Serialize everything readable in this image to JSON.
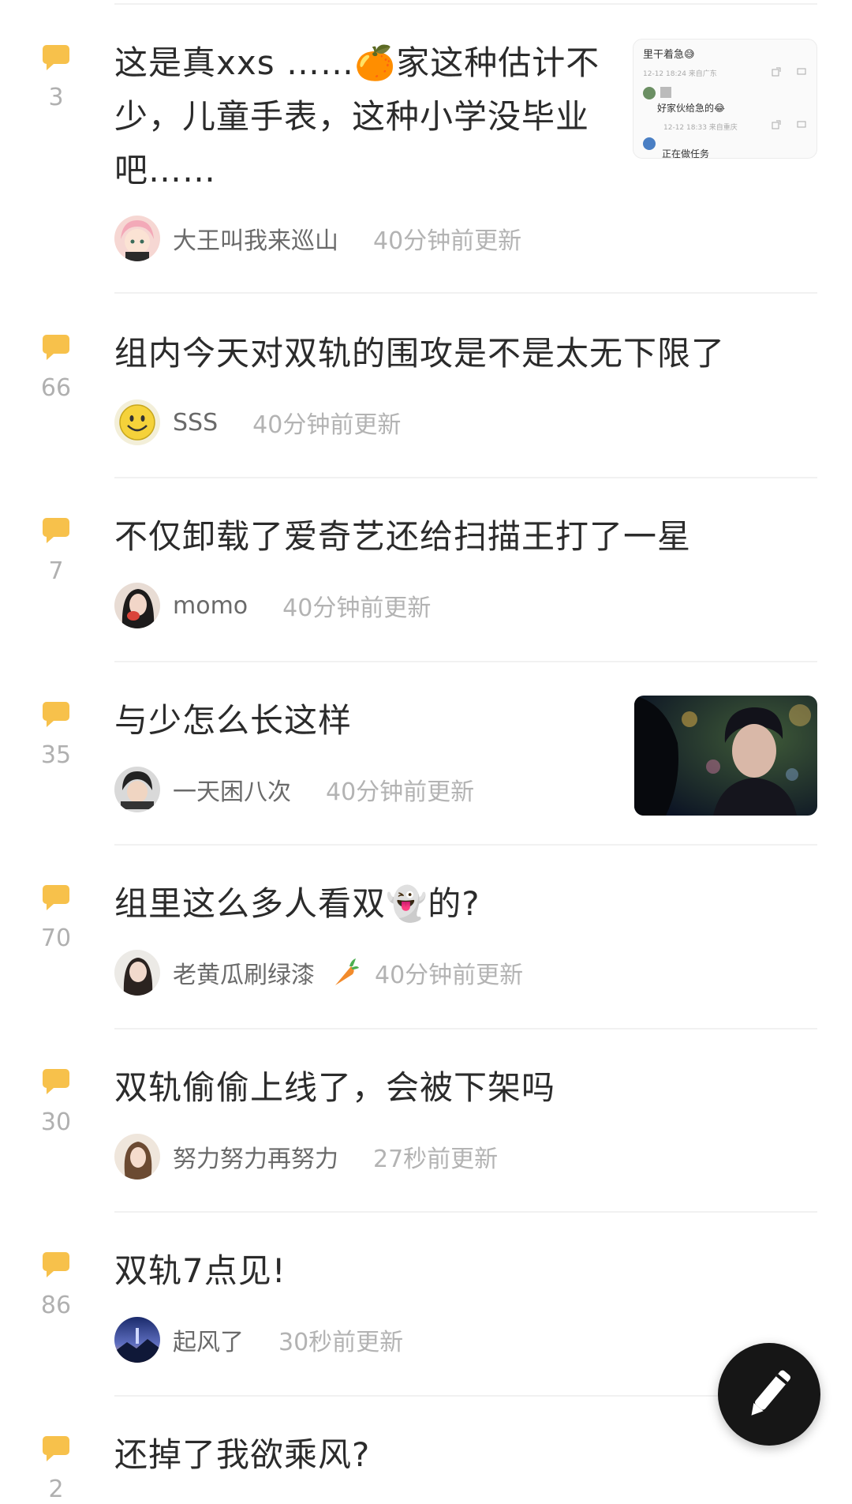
{
  "theme": {
    "accent": "#f7c14b",
    "divider": "#f1f1f1",
    "fab": "#161616"
  },
  "posts": [
    {
      "title": "这是真xxs ……🍊家这种估计不少，儿童手表，这种小学没毕业吧……",
      "comments": "3",
      "author": "大王叫我来巡山",
      "time": "40分钟前更新",
      "avatar": "pink-hair-anime-avatar",
      "thumbnail": "chat-screenshot-thumbnail"
    },
    {
      "title": "组内今天对双轨的围攻是不是太无下限了",
      "comments": "66",
      "author": "SSS",
      "time": "40分钟前更新",
      "avatar": "smiley-face-avatar"
    },
    {
      "title": "不仅卸载了爱奇艺还给扫描王打了一星",
      "comments": "7",
      "author": "momo",
      "time": "40分钟前更新",
      "avatar": "girl-photo-avatar"
    },
    {
      "title": "与少怎么长这样",
      "comments": "35",
      "author": "一天困八次",
      "time": "40分钟前更新",
      "avatar": "cartoon-boy-avatar",
      "thumbnail": "drama-still-thumbnail"
    },
    {
      "title": "组里这么多人看双👻的?",
      "comments": "70",
      "author": "老黄瓜刷绿漆",
      "time": "40分钟前更新",
      "avatar": "woman-photo-avatar",
      "badge": "carrot-icon"
    },
    {
      "title": "双轨偷偷上线了，会被下架吗",
      "comments": "30",
      "author": "努力努力再努力",
      "time": "27秒前更新",
      "avatar": "woman-selfie-avatar"
    },
    {
      "title": "双轨7点见!",
      "comments": "86",
      "author": "起风了",
      "time": "30秒前更新",
      "avatar": "night-landscape-avatar"
    },
    {
      "title": "还掉了我欲乘风?",
      "comments": "2",
      "author": "",
      "time": "",
      "avatar": ""
    }
  ],
  "thumb_chat": {
    "line1": "里干着急😅",
    "date1": "12-12 18:24 来自广东",
    "line2": "好家伙给急的😂",
    "date2": "12-12 18:33 来自重庆",
    "line3": "正在做任务"
  },
  "fab": {
    "icon": "pen-icon"
  }
}
